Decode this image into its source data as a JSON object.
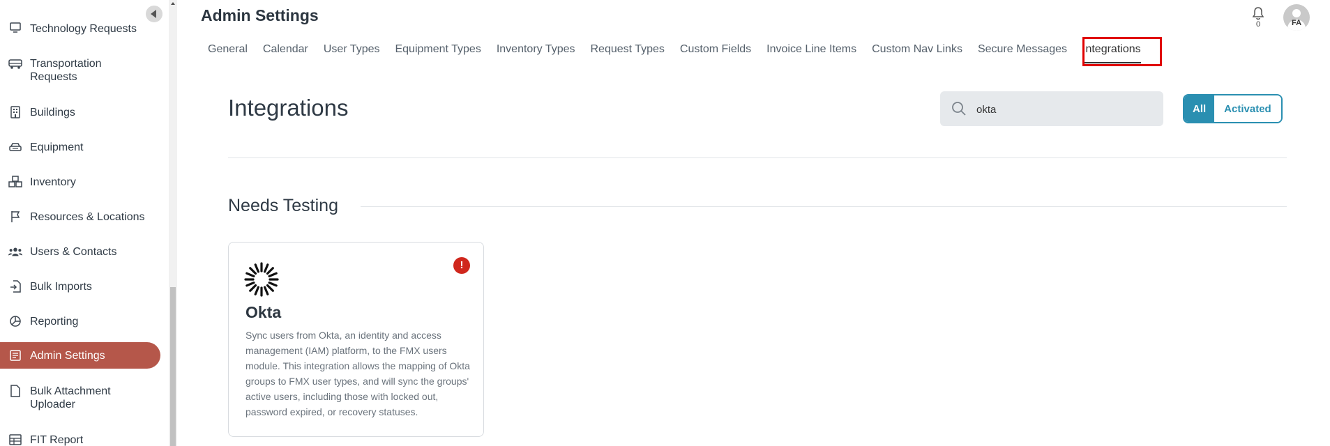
{
  "sidebar": {
    "items": [
      {
        "label": "Technology Requests",
        "icon": "technology-icon"
      },
      {
        "label": "Transportation Requests",
        "icon": "bus-icon"
      },
      {
        "label": "Buildings",
        "icon": "building-icon"
      },
      {
        "label": "Equipment",
        "icon": "equipment-icon"
      },
      {
        "label": "Inventory",
        "icon": "inventory-boxes-icon"
      },
      {
        "label": "Resources & Locations",
        "icon": "flag-icon"
      },
      {
        "label": "Users & Contacts",
        "icon": "users-icon"
      },
      {
        "label": "Bulk Imports",
        "icon": "import-icon"
      },
      {
        "label": "Reporting",
        "icon": "pie-chart-icon"
      },
      {
        "label": "Admin Settings",
        "icon": "admin-settings-icon",
        "active": true
      },
      {
        "label": "Bulk Attachment Uploader",
        "icon": "document-icon"
      },
      {
        "label": "FIT Report",
        "icon": "table-icon"
      }
    ]
  },
  "header": {
    "title": "Admin Settings",
    "tabs": [
      {
        "label": "General"
      },
      {
        "label": "Calendar"
      },
      {
        "label": "User Types"
      },
      {
        "label": "Equipment Types"
      },
      {
        "label": "Inventory Types"
      },
      {
        "label": "Request Types"
      },
      {
        "label": "Custom Fields"
      },
      {
        "label": "Invoice Line Items"
      },
      {
        "label": "Custom Nav Links"
      },
      {
        "label": "Secure Messages"
      },
      {
        "label": "Integrations",
        "active": true
      }
    ],
    "notification_count": "0",
    "avatar_initials": "FA"
  },
  "main": {
    "title": "Integrations",
    "search": {
      "value": "okta",
      "placeholder": ""
    },
    "filters": {
      "all_label": "All",
      "activated_label": "Activated",
      "selected": "All"
    },
    "section_title": "Needs Testing",
    "cards": [
      {
        "name": "Okta",
        "alert": "!",
        "description": "Sync users from Okta, an identity and access management (IAM) platform, to the FMX users module. This integration allows the mapping of Okta groups to FMX user types, and will sync the groups' active users, including those with locked out, password expired, or recovery statuses."
      }
    ]
  },
  "colors": {
    "active_nav": "#b5574a",
    "accent": "#2a8fb1",
    "alert": "#d0271d",
    "highlight": "#e00000"
  }
}
